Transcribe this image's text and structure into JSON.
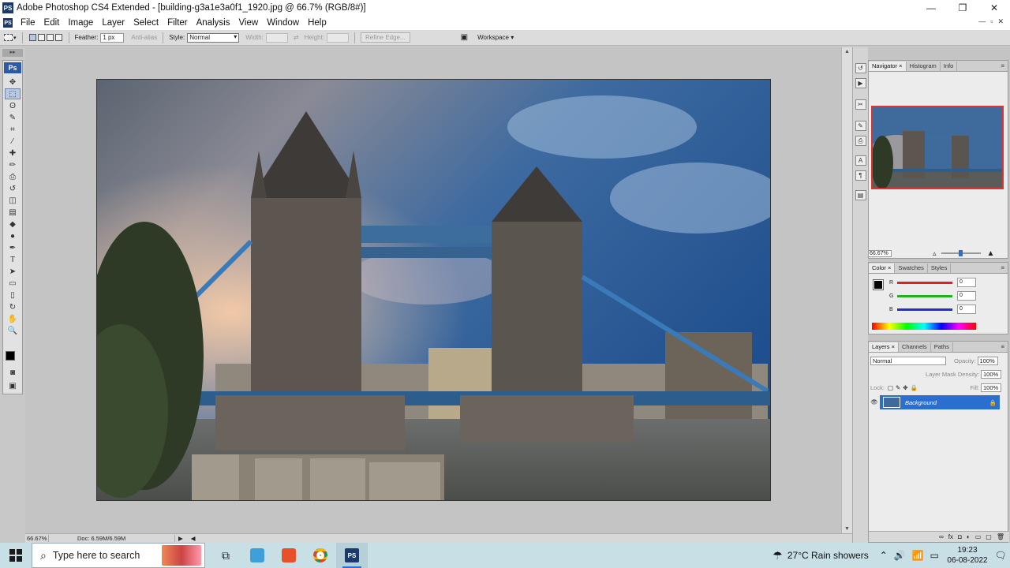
{
  "window": {
    "app_icon": "PS",
    "title": "Adobe Photoshop CS4 Extended - [building-g3a1e3a0f1_1920.jpg @ 66.7% (RGB/8#)]",
    "minimize": "—",
    "restore": "❐",
    "close": "✕"
  },
  "menu": {
    "items": [
      "File",
      "Edit",
      "Image",
      "Layer",
      "Select",
      "Filter",
      "Analysis",
      "View",
      "Window",
      "Help"
    ],
    "mdi_min": "—",
    "mdi_restore": "▫",
    "mdi_close": "✕"
  },
  "options": {
    "feather_label": "Feather:",
    "feather_value": "1 px",
    "anti_alias": "Anti-alias",
    "style_label": "Style:",
    "style_value": "Normal",
    "width_label": "Width:",
    "height_label": "Height:",
    "refine_edge": "Refine Edge...",
    "workspace": "Workspace ▾"
  },
  "toolbox": {
    "badge": "Ps",
    "head": "▸▸",
    "tools": [
      "move-tool",
      "marquee-tool",
      "lasso-tool",
      "quick-select-tool",
      "crop-tool",
      "eyedropper-tool",
      "healing-brush-tool",
      "brush-tool",
      "clone-stamp-tool",
      "history-brush-tool",
      "eraser-tool",
      "gradient-tool",
      "blur-tool",
      "dodge-tool",
      "pen-tool",
      "type-tool",
      "path-select-tool",
      "shape-tool",
      "notes-tool",
      "3d-rotate-tool",
      "hand-tool",
      "zoom-tool"
    ],
    "glyphs": [
      "✥",
      "⬚",
      "ʘ",
      "✎",
      "⌗",
      "⁄",
      "✚",
      "✏",
      "⎙",
      "↺",
      "◫",
      "▤",
      "◆",
      "●",
      "✒",
      "T",
      "➤",
      "▭",
      "▯",
      "↻",
      "✋",
      "🔍"
    ],
    "foreground_color": "#000000"
  },
  "status": {
    "zoom": "66.67%",
    "doc": "Doc: 6.59M/6.59M"
  },
  "navigator": {
    "tabs": [
      "Navigator ×",
      "Histogram",
      "Info"
    ],
    "zoom": "66.67%"
  },
  "color_panel": {
    "tabs": [
      "Color ×",
      "Swatches",
      "Styles"
    ],
    "channels": [
      {
        "label": "R",
        "value": "0",
        "color": "#e02020"
      },
      {
        "label": "G",
        "value": "0",
        "color": "#20b020"
      },
      {
        "label": "B",
        "value": "0",
        "color": "#2030d0"
      }
    ]
  },
  "layers_panel": {
    "tabs": [
      "Layers ×",
      "Channels",
      "Paths"
    ],
    "blend_mode": "Normal",
    "opacity_label": "Opacity:",
    "opacity_value": "100%",
    "mask_density_label": "Layer Mask Density:",
    "mask_density_value": "100%",
    "lock_label": "Lock:",
    "fill_label": "Fill:",
    "fill_value": "100%",
    "layers": [
      {
        "name": "Background",
        "selected": true
      }
    ]
  },
  "taskbar": {
    "search_placeholder": "Type here to search",
    "weather": "27°C  Rain showers",
    "time": "19:23",
    "date": "06-08-2022",
    "accent": "#2a6fd0"
  }
}
